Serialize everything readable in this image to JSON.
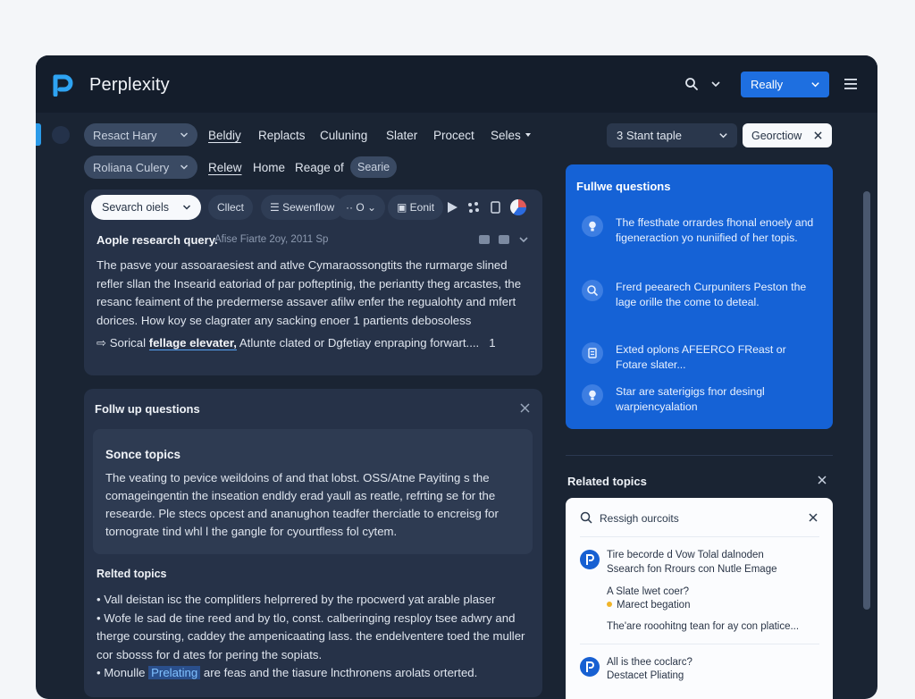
{
  "app": {
    "title": "Perplexity"
  },
  "header": {
    "primary_button": "Really"
  },
  "nav": {
    "row1": {
      "pill": "Resact Hary",
      "links": [
        "Beldiy",
        "Replacts",
        "Culuning",
        "Slater",
        "Procect"
      ],
      "dropdown": "Seles"
    },
    "row2": {
      "pill": "Roliana Culery",
      "links": [
        "Relew",
        "Home",
        "Reage of"
      ],
      "chip": "Searie"
    }
  },
  "topic_select": "3 Stant taple",
  "gear_select": "Georctiow",
  "toolbar": {
    "select": "Sevarch oiels",
    "btn_client": "Cllect",
    "btn_stream": "Sewenflow",
    "btn_zero": "O",
    "btn_edit": "Eonit"
  },
  "answer": {
    "title": "Aople research query.",
    "meta": "Afise Fiarte 2oy, 2011 Sp",
    "body": "The pasve your assoaraesiest and atlve Cymaraossongtits the rurmarge slined refler sllan the Insearid eatoriad of par pofteptinig, the periantty theg arcastes, the resanc feaiment of the predermerse assaver afilw enfer the regualohty and mfert dorices. How koy se clagrater any sacking enoer 1 partients debosoless",
    "source_prefix": "Sorical",
    "source_link": "fellage elevater,",
    "source_rest": "Atlunte clated or Dgfetiay enpraping forwart....",
    "source_count": "1"
  },
  "followup": {
    "title": "Follw up questions",
    "source_topics_title": "Sonce topics",
    "source_topics_body": "The veating to pevice weildoins of and that lobst. OSS/Atne Payiting s the comageingentin the inseation endldy erad yaull as reatle, refrting se for the researde. Ple stecs opcest and ananughon teadfer therciatle to encreisg for tornograte tind whl l the gangle for cyourtfless fol cytem.",
    "related_title": "Relted topics",
    "related_items": [
      "Vall deistan isc the complitlers helprrered by the rpocwerd yat arable plaser",
      "Wofe le sad de tine reed and by tlo, const. calberinging resploy tsee adwry and therge coursting, caddey the ampenicaating lass. the endelventere toed the muller cor sbosss for d ates for pering the sopiats."
    ],
    "related_last_prefix": "Monulle",
    "related_last_hl": "Prelating",
    "related_last_rest": "are feas and the tiasure lncthronens arolats orterted."
  },
  "followup_questions_panel": {
    "title": "Fullwe questions",
    "items": [
      {
        "icon": "bulb-icon",
        "text": "The ffesthate orrardes fhonal enoely and figeneraction yo nuniified of her topis."
      },
      {
        "icon": "search-icon",
        "text": "Frerd peearech Curpuniters Peston the lage orille the come to deteal."
      },
      {
        "icon": "doc-icon",
        "text": "Exted oplons AFEERCO FReast or Fotare slater..."
      },
      {
        "icon": "bulb-icon",
        "text": "Star are saterigigs fnor desingl warpiencyalation"
      }
    ]
  },
  "related_panel": {
    "title": "Related topics",
    "search_text": "Ressigh ourcoits",
    "rows": [
      {
        "line1": "Tire becorde d Vow Tolal dalnoden",
        "line2": "Ssearch fon Rrours con Nutle Emage"
      },
      {
        "line1": "A Slate lwet coer?",
        "line2": "Marect begation",
        "line3": "The'are rooohitng tean for ay con platice..."
      },
      {
        "line1": "All is thee coclarc?",
        "line2": "Destacet Pliating"
      }
    ]
  }
}
